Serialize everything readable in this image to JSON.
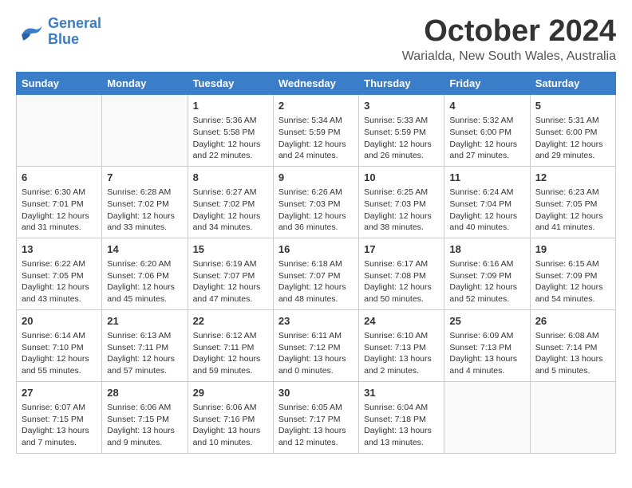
{
  "logo": {
    "line1": "General",
    "line2": "Blue"
  },
  "title": "October 2024",
  "subtitle": "Warialda, New South Wales, Australia",
  "days_of_week": [
    "Sunday",
    "Monday",
    "Tuesday",
    "Wednesday",
    "Thursday",
    "Friday",
    "Saturday"
  ],
  "weeks": [
    [
      {
        "day": "",
        "info": ""
      },
      {
        "day": "",
        "info": ""
      },
      {
        "day": "1",
        "info": "Sunrise: 5:36 AM\nSunset: 5:58 PM\nDaylight: 12 hours\nand 22 minutes."
      },
      {
        "day": "2",
        "info": "Sunrise: 5:34 AM\nSunset: 5:59 PM\nDaylight: 12 hours\nand 24 minutes."
      },
      {
        "day": "3",
        "info": "Sunrise: 5:33 AM\nSunset: 5:59 PM\nDaylight: 12 hours\nand 26 minutes."
      },
      {
        "day": "4",
        "info": "Sunrise: 5:32 AM\nSunset: 6:00 PM\nDaylight: 12 hours\nand 27 minutes."
      },
      {
        "day": "5",
        "info": "Sunrise: 5:31 AM\nSunset: 6:00 PM\nDaylight: 12 hours\nand 29 minutes."
      }
    ],
    [
      {
        "day": "6",
        "info": "Sunrise: 6:30 AM\nSunset: 7:01 PM\nDaylight: 12 hours\nand 31 minutes."
      },
      {
        "day": "7",
        "info": "Sunrise: 6:28 AM\nSunset: 7:02 PM\nDaylight: 12 hours\nand 33 minutes."
      },
      {
        "day": "8",
        "info": "Sunrise: 6:27 AM\nSunset: 7:02 PM\nDaylight: 12 hours\nand 34 minutes."
      },
      {
        "day": "9",
        "info": "Sunrise: 6:26 AM\nSunset: 7:03 PM\nDaylight: 12 hours\nand 36 minutes."
      },
      {
        "day": "10",
        "info": "Sunrise: 6:25 AM\nSunset: 7:03 PM\nDaylight: 12 hours\nand 38 minutes."
      },
      {
        "day": "11",
        "info": "Sunrise: 6:24 AM\nSunset: 7:04 PM\nDaylight: 12 hours\nand 40 minutes."
      },
      {
        "day": "12",
        "info": "Sunrise: 6:23 AM\nSunset: 7:05 PM\nDaylight: 12 hours\nand 41 minutes."
      }
    ],
    [
      {
        "day": "13",
        "info": "Sunrise: 6:22 AM\nSunset: 7:05 PM\nDaylight: 12 hours\nand 43 minutes."
      },
      {
        "day": "14",
        "info": "Sunrise: 6:20 AM\nSunset: 7:06 PM\nDaylight: 12 hours\nand 45 minutes."
      },
      {
        "day": "15",
        "info": "Sunrise: 6:19 AM\nSunset: 7:07 PM\nDaylight: 12 hours\nand 47 minutes."
      },
      {
        "day": "16",
        "info": "Sunrise: 6:18 AM\nSunset: 7:07 PM\nDaylight: 12 hours\nand 48 minutes."
      },
      {
        "day": "17",
        "info": "Sunrise: 6:17 AM\nSunset: 7:08 PM\nDaylight: 12 hours\nand 50 minutes."
      },
      {
        "day": "18",
        "info": "Sunrise: 6:16 AM\nSunset: 7:09 PM\nDaylight: 12 hours\nand 52 minutes."
      },
      {
        "day": "19",
        "info": "Sunrise: 6:15 AM\nSunset: 7:09 PM\nDaylight: 12 hours\nand 54 minutes."
      }
    ],
    [
      {
        "day": "20",
        "info": "Sunrise: 6:14 AM\nSunset: 7:10 PM\nDaylight: 12 hours\nand 55 minutes."
      },
      {
        "day": "21",
        "info": "Sunrise: 6:13 AM\nSunset: 7:11 PM\nDaylight: 12 hours\nand 57 minutes."
      },
      {
        "day": "22",
        "info": "Sunrise: 6:12 AM\nSunset: 7:11 PM\nDaylight: 12 hours\nand 59 minutes."
      },
      {
        "day": "23",
        "info": "Sunrise: 6:11 AM\nSunset: 7:12 PM\nDaylight: 13 hours\nand 0 minutes."
      },
      {
        "day": "24",
        "info": "Sunrise: 6:10 AM\nSunset: 7:13 PM\nDaylight: 13 hours\nand 2 minutes."
      },
      {
        "day": "25",
        "info": "Sunrise: 6:09 AM\nSunset: 7:13 PM\nDaylight: 13 hours\nand 4 minutes."
      },
      {
        "day": "26",
        "info": "Sunrise: 6:08 AM\nSunset: 7:14 PM\nDaylight: 13 hours\nand 5 minutes."
      }
    ],
    [
      {
        "day": "27",
        "info": "Sunrise: 6:07 AM\nSunset: 7:15 PM\nDaylight: 13 hours\nand 7 minutes."
      },
      {
        "day": "28",
        "info": "Sunrise: 6:06 AM\nSunset: 7:15 PM\nDaylight: 13 hours\nand 9 minutes."
      },
      {
        "day": "29",
        "info": "Sunrise: 6:06 AM\nSunset: 7:16 PM\nDaylight: 13 hours\nand 10 minutes."
      },
      {
        "day": "30",
        "info": "Sunrise: 6:05 AM\nSunset: 7:17 PM\nDaylight: 13 hours\nand 12 minutes."
      },
      {
        "day": "31",
        "info": "Sunrise: 6:04 AM\nSunset: 7:18 PM\nDaylight: 13 hours\nand 13 minutes."
      },
      {
        "day": "",
        "info": ""
      },
      {
        "day": "",
        "info": ""
      }
    ]
  ]
}
